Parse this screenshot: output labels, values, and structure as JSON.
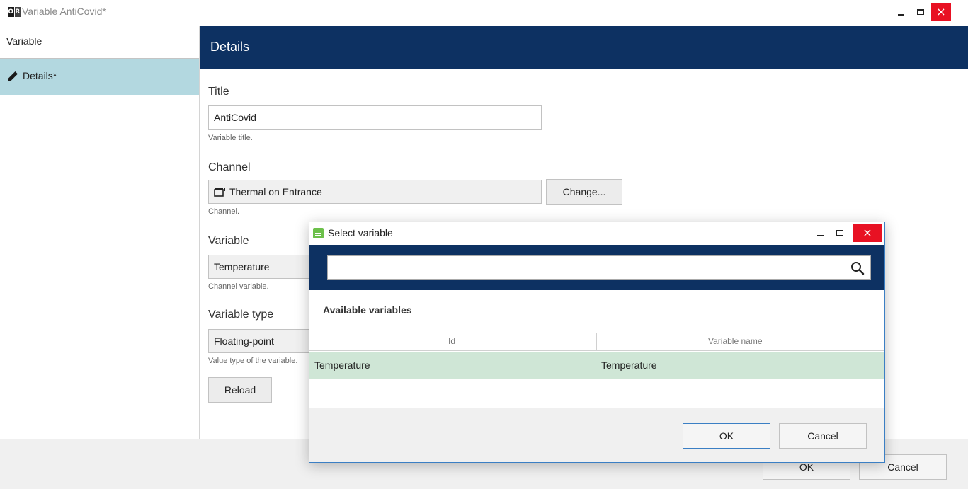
{
  "window": {
    "title": "Variable AntiCovid*",
    "icon_letters": [
      "O",
      "R"
    ],
    "icons": {
      "minimize": "minimize-icon",
      "maximize": "maximize-icon",
      "close": "close-icon"
    }
  },
  "sidebar": {
    "header": "Variable",
    "items": [
      {
        "label": "Details*",
        "icon": "pencil-icon",
        "selected": true
      }
    ]
  },
  "details": {
    "header": "Details",
    "fields": {
      "title": {
        "label": "Title",
        "value": "AntiCovid",
        "hint": "Variable title."
      },
      "channel": {
        "label": "Channel",
        "value": "Thermal on Entrance",
        "hint": "Channel.",
        "button": "Change...",
        "icon": "channel-camera-icon"
      },
      "variable": {
        "label": "Variable",
        "value": "Temperature",
        "hint": "Channel variable."
      },
      "variable_type": {
        "label": "Variable type",
        "value": "Floating-point",
        "hint": "Value type of the variable."
      }
    },
    "reload_button": "Reload"
  },
  "footer": {
    "ok": "OK",
    "cancel": "Cancel"
  },
  "dialog": {
    "title": "Select variable",
    "search": {
      "value": "",
      "icon": "search-icon"
    },
    "section_title": "Available variables",
    "columns": [
      "Id",
      "Variable name"
    ],
    "rows": [
      {
        "id": "Temperature",
        "name": "Temperature",
        "selected": true
      }
    ],
    "ok": "OK",
    "cancel": "Cancel"
  },
  "colors": {
    "header_navy": "#0d3162",
    "sidebar_selected": "#b3d8e0",
    "row_selected": "#cfe6d6",
    "close_red": "#e81123",
    "dialog_border": "#3b7fc4"
  }
}
